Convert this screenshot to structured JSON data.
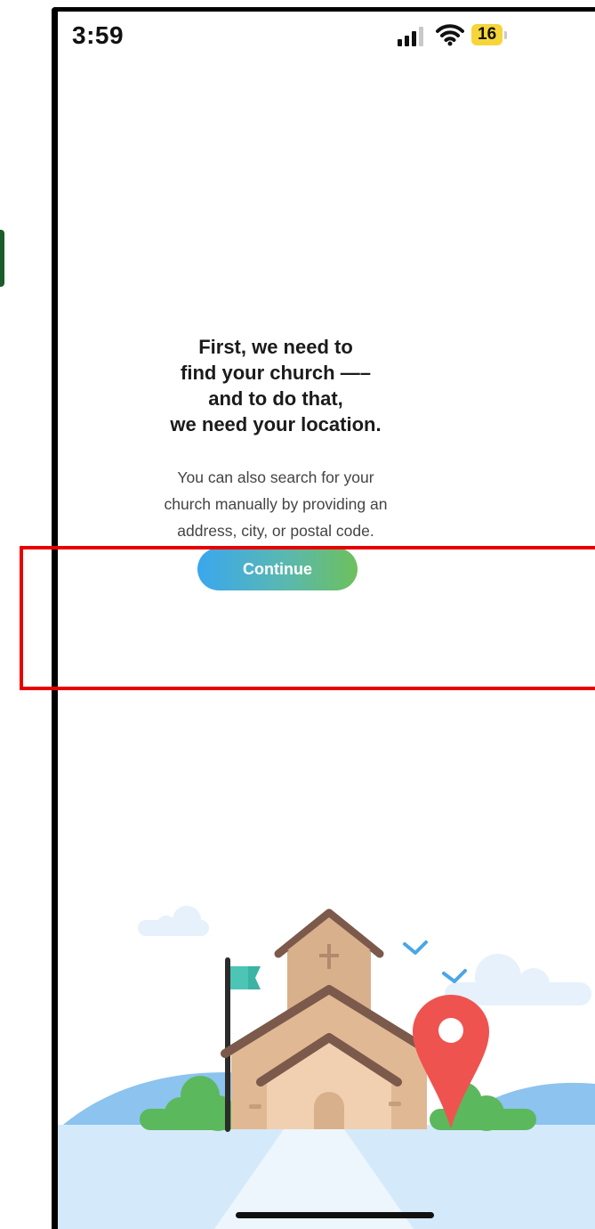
{
  "status_bar": {
    "time": "3:59",
    "battery_level": "16",
    "icons": [
      "signal-bars-icon",
      "wifi-icon",
      "battery-icon"
    ]
  },
  "onboarding": {
    "heading_lines": [
      "First, we need to",
      "find your church —–",
      "and to do that,",
      "we need your location."
    ],
    "subtext_lines": [
      "You can also search for your",
      "church manually by providing an",
      "address, city, or postal code."
    ],
    "continue_label": "Continue"
  },
  "colors": {
    "button_gradient_start": "#3aa7ee",
    "button_gradient_end": "#6dc05c",
    "highlight": "#e80000",
    "battery": "#f6d53a"
  },
  "illustration": {
    "icons": [
      "church-icon",
      "flag-icon",
      "map-pin-icon",
      "bird-icon",
      "cloud-icon",
      "tree-icon"
    ]
  }
}
